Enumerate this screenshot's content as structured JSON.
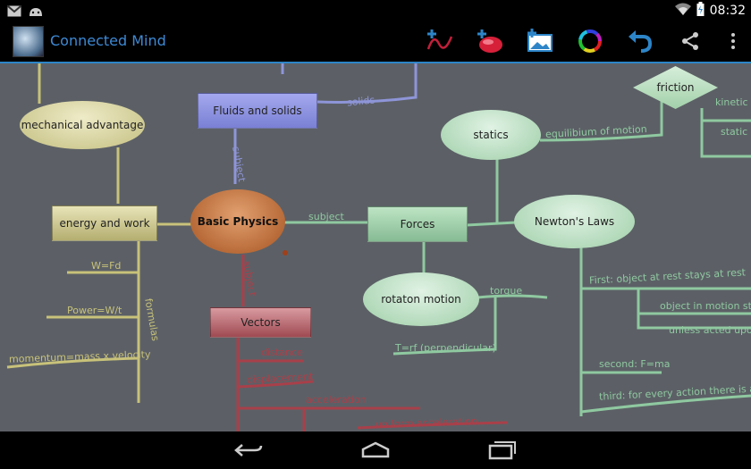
{
  "status_bar": {
    "time": "08:32"
  },
  "app": {
    "title": "Connected Mind"
  },
  "toolbar": {
    "icons": [
      "add-link-icon",
      "add-node-icon",
      "add-image-icon",
      "color-wheel-icon",
      "undo-icon",
      "share-icon",
      "overflow-menu-icon"
    ]
  },
  "nodes": {
    "fluids": "Fluids and solids",
    "mech": "mechanical advantage",
    "energy": "energy and work",
    "basic": "Basic Physics",
    "forces": "Forces",
    "statics": "statics",
    "newton": "Newton's Laws",
    "friction": "friction",
    "rotation": "rotaton motion",
    "vectors": "Vectors"
  },
  "labels": {
    "solids": "solids",
    "subject_up": "subject",
    "subject_right": "subject",
    "subject_down": "subject",
    "equilibrium": "equilibium of motion",
    "kinetic": "kinetic",
    "static": "static",
    "torque": "torque",
    "trf": "T=rf (perpendicular)",
    "formulas": "formulas",
    "wfd": "W=Fd",
    "power": "Power=W/t",
    "momentum": "momentum=mass x velocity",
    "first": "First: object at rest stays at rest",
    "motion": "object in motion stays",
    "unless": "unless acted upon",
    "second": "second: F=ma",
    "third": "third: for every action there is an",
    "distance": "distance",
    "displacement": "displacement",
    "acceleration": "acceleration",
    "uniform": "uniform acceleration"
  },
  "colors": {
    "accent": "#2d85c8",
    "canvas": "#5c6066",
    "green_line": "#8fc9a0",
    "olive_line": "#c8c27a",
    "red_line": "#a8404a",
    "blue_line": "#8e95d8"
  }
}
